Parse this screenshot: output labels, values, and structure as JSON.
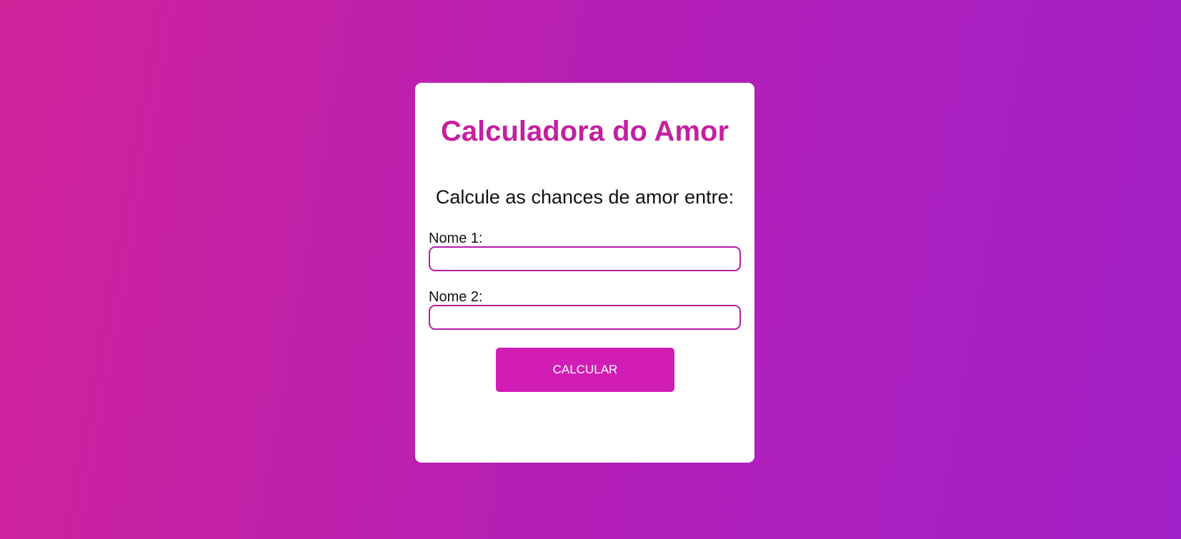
{
  "app": {
    "title": "Calculadora do Amor",
    "subtitle": "Calcule as chances de amor entre:"
  },
  "form": {
    "name1": {
      "label": "Nome 1:",
      "value": "",
      "placeholder": ""
    },
    "name2": {
      "label": "Nome 2:",
      "value": "",
      "placeholder": ""
    },
    "submit_label": "CALCULAR"
  },
  "colors": {
    "background_start": "#d0239a",
    "background_end": "#a220c8",
    "title": "#c4209f",
    "input_border": "#b21ea3",
    "button": "#d21db5"
  }
}
